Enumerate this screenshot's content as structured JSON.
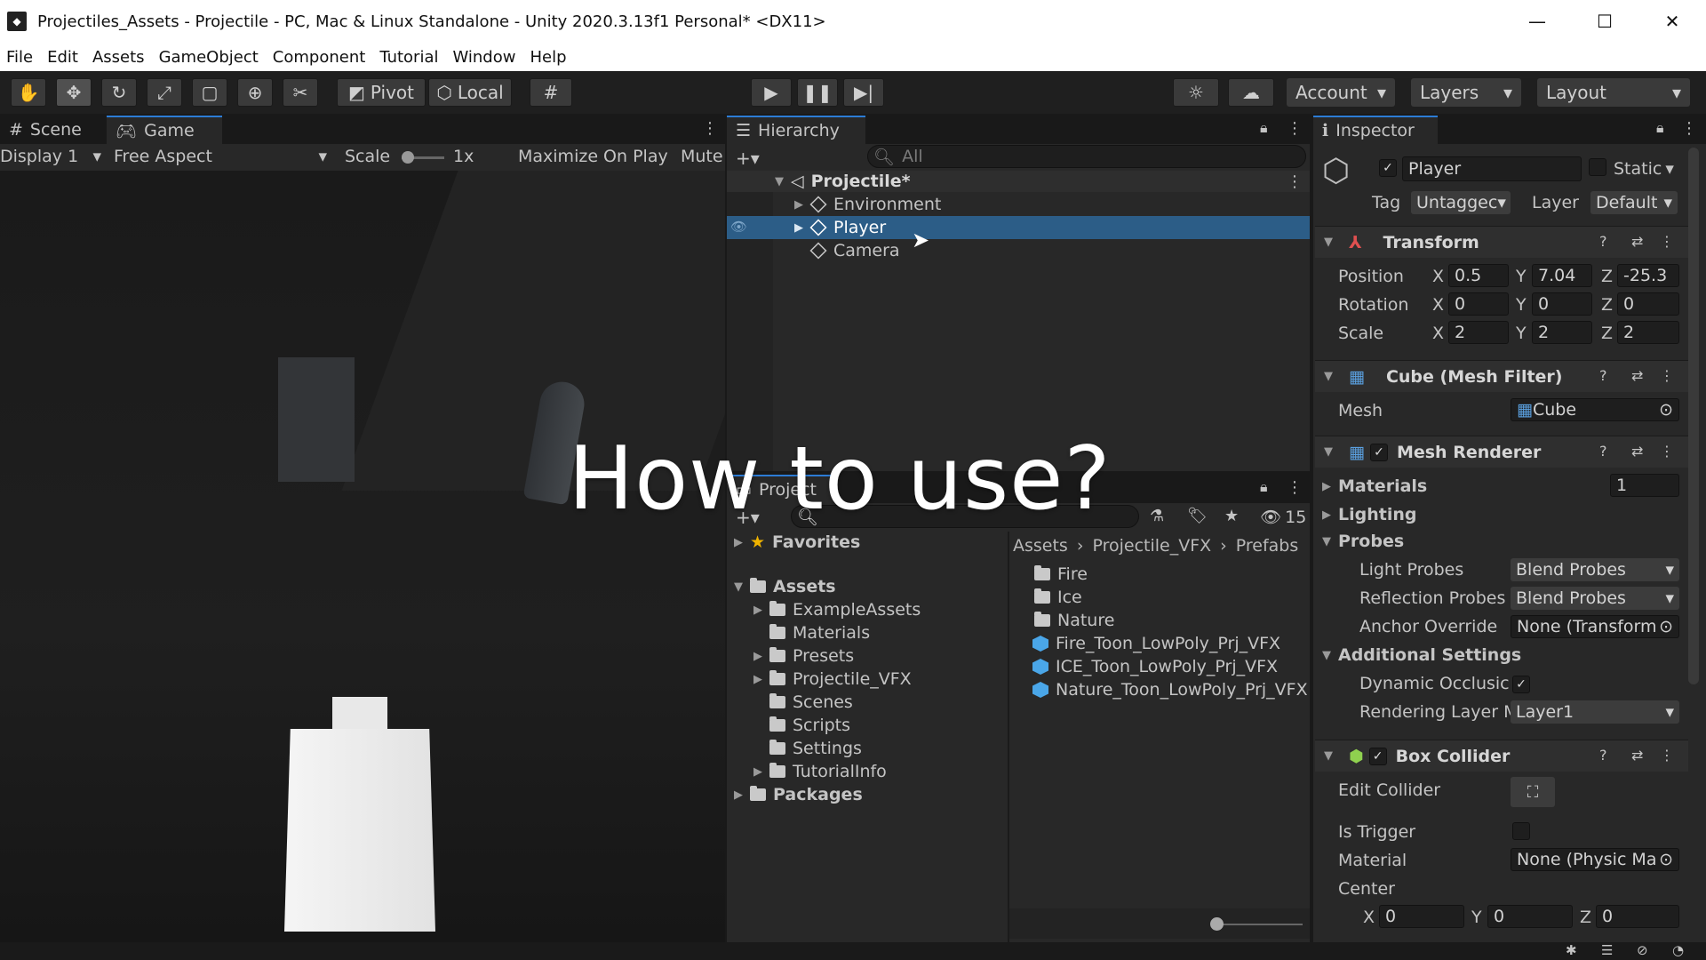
{
  "window": {
    "title": "Projectiles_Assets - Projectile - PC, Mac & Linux Standalone - Unity 2020.3.13f1 Personal* <DX11>",
    "minimize": "—",
    "maximize": "☐",
    "close": "✕"
  },
  "menu": [
    "File",
    "Edit",
    "Assets",
    "GameObject",
    "Component",
    "Tutorial",
    "Window",
    "Help"
  ],
  "toolbar": {
    "pivot": "Pivot",
    "local": "Local",
    "account": "Account",
    "layers": "Layers",
    "layout": "Layout"
  },
  "game": {
    "tab_scene": "Scene",
    "tab_game": "Game",
    "display": "Display 1",
    "aspect": "Free Aspect",
    "scale_label": "Scale",
    "scale_value": "1x",
    "maximize": "Maximize On Play",
    "mute": "Mute",
    "overlay_text": "How to use?"
  },
  "hierarchy": {
    "tab": "Hierarchy",
    "search_placeholder": "All",
    "scene": "Projectile*",
    "items": [
      "Environment",
      "Player",
      "Camera"
    ]
  },
  "project": {
    "tab": "Project",
    "hidden_count": "15",
    "favorites": "Favorites",
    "assets": "Assets",
    "asset_folders": [
      "ExampleAssets",
      "Materials",
      "Presets",
      "Projectile_VFX",
      "Scenes",
      "Scripts",
      "Settings",
      "TutorialInfo"
    ],
    "packages": "Packages",
    "breadcrumb": [
      "Assets",
      "Projectile_VFX",
      "Prefabs"
    ],
    "folders": [
      "Fire",
      "Ice",
      "Nature"
    ],
    "prefabs": [
      "Fire_Toon_LowPoly_Prj_VFX",
      "ICE_Toon_LowPoly_Prj_VFX",
      "Nature_Toon_LowPoly_Prj_VFX"
    ]
  },
  "inspector": {
    "tab": "Inspector",
    "name": "Player",
    "static": "Static",
    "tag_label": "Tag",
    "tag": "Untaggec",
    "layer_label": "Layer",
    "layer": "Default",
    "transform": {
      "title": "Transform",
      "position_label": "Position",
      "position": [
        "0.5",
        "7.04",
        "-25.3"
      ],
      "rotation_label": "Rotation",
      "rotation": [
        "0",
        "0",
        "0"
      ],
      "scale_label": "Scale",
      "scale": [
        "2",
        "2",
        "2"
      ]
    },
    "mesh_filter": {
      "title": "Cube (Mesh Filter)",
      "mesh_label": "Mesh",
      "mesh": "Cube"
    },
    "mesh_renderer": {
      "title": "Mesh Renderer",
      "materials": "Materials",
      "materials_count": "1",
      "lighting": "Lighting",
      "probes": "Probes",
      "light_probes_label": "Light Probes",
      "light_probes": "Blend Probes",
      "reflection_probes_label": "Reflection Probes",
      "reflection_probes": "Blend Probes",
      "anchor_label": "Anchor Override",
      "anchor": "None (Transform",
      "additional": "Additional Settings",
      "dynamic_label": "Dynamic Occlusic",
      "rendering_layer_label": "Rendering Layer M",
      "rendering_layer": "Layer1"
    },
    "box_collider": {
      "title": "Box Collider",
      "edit_label": "Edit Collider",
      "trigger_label": "Is Trigger",
      "material_label": "Material",
      "material": "None (Physic Ma",
      "center_label": "Center",
      "center": [
        "0",
        "0",
        "0"
      ]
    }
  }
}
